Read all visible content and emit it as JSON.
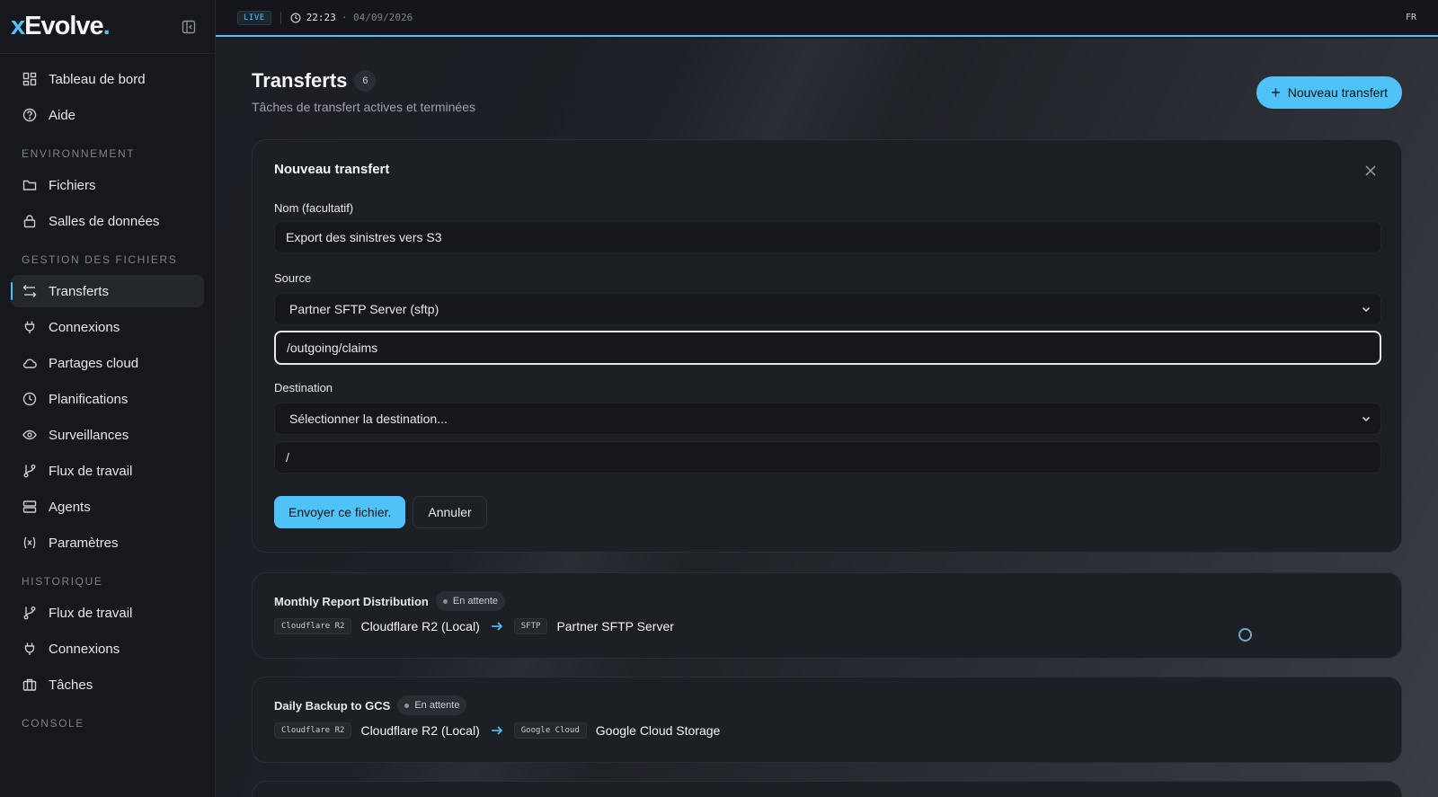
{
  "app": {
    "logo_prefix": "x",
    "logo_main": "Evolve",
    "logo_dot": "."
  },
  "topbar": {
    "live": "LIVE",
    "time": "22:23",
    "date": "· 04/09/2026",
    "lang": "FR"
  },
  "sidebar": {
    "top_items": [
      {
        "label": "Tableau de bord",
        "icon": "dashboard-icon"
      },
      {
        "label": "Aide",
        "icon": "help-icon"
      }
    ],
    "sections": [
      {
        "title": "ENVIRONNEMENT",
        "items": [
          {
            "label": "Fichiers",
            "icon": "folder-icon"
          },
          {
            "label": "Salles de données",
            "icon": "lock-icon"
          }
        ]
      },
      {
        "title": "GESTION DES FICHIERS",
        "items": [
          {
            "label": "Transferts",
            "icon": "transfer-icon",
            "active": true
          },
          {
            "label": "Connexions",
            "icon": "plug-icon"
          },
          {
            "label": "Partages cloud",
            "icon": "cloud-icon"
          },
          {
            "label": "Planifications",
            "icon": "clock-icon"
          },
          {
            "label": "Surveillances",
            "icon": "eye-icon"
          },
          {
            "label": "Flux de travail",
            "icon": "workflow-icon"
          },
          {
            "label": "Agents",
            "icon": "server-icon"
          },
          {
            "label": "Paramètres",
            "icon": "variable-icon"
          }
        ]
      },
      {
        "title": "HISTORIQUE",
        "items": [
          {
            "label": "Flux de travail",
            "icon": "workflow-icon"
          },
          {
            "label": "Connexions",
            "icon": "plug-icon"
          },
          {
            "label": "Tâches",
            "icon": "briefcase-icon"
          }
        ]
      },
      {
        "title": "CONSOLE",
        "items": []
      }
    ]
  },
  "page": {
    "title": "Transferts",
    "count": "6",
    "subtitle": "Tâches de transfert actives et terminées",
    "new_button": "Nouveau transfert"
  },
  "form": {
    "title": "Nouveau transfert",
    "name_label": "Nom (facultatif)",
    "name_value": "Export des sinistres vers S3",
    "source_label": "Source",
    "source_value": "Partner SFTP Server (sftp)",
    "source_path": "/outgoing/claims",
    "destination_label": "Destination",
    "destination_value": "Sélectionner la destination...",
    "destination_path": "/",
    "submit": "Envoyer ce fichier.",
    "cancel": "Annuler"
  },
  "transfers": [
    {
      "name": "Monthly Report Distribution",
      "status": "En attente",
      "source_tag": "Cloudflare R2",
      "source": "Cloudflare R2 (Local)",
      "dest_tag": "SFTP",
      "dest": "Partner SFTP Server"
    },
    {
      "name": "Daily Backup to GCS",
      "status": "En attente",
      "source_tag": "Cloudflare R2",
      "source": "Cloudflare R2 (Local)",
      "dest_tag": "Google Cloud",
      "dest": "Google Cloud Storage"
    }
  ],
  "colors": {
    "accent": "#4fc3f7",
    "background": "#1b1e23",
    "sidebar": "#16181c"
  }
}
